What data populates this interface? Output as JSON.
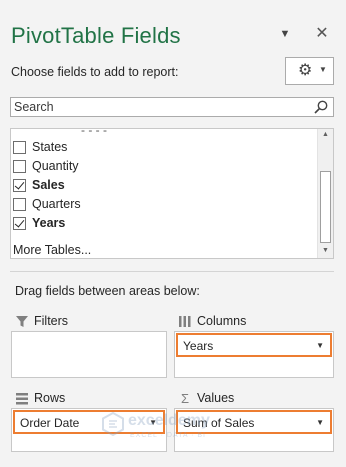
{
  "pane": {
    "title": "PivotTable Fields",
    "dropdown_glyph": "▼",
    "close_glyph": "✕",
    "choose_label": "Choose fields to add to report:",
    "tools_icon": "gear-icon"
  },
  "search": {
    "placeholder": "Search",
    "value": ""
  },
  "fields": {
    "items": [
      {
        "label": "States",
        "checked": false
      },
      {
        "label": "Quantity",
        "checked": false
      },
      {
        "label": "Sales",
        "checked": true
      },
      {
        "label": "Quarters",
        "checked": false
      },
      {
        "label": "Years",
        "checked": true
      }
    ],
    "more_tables": "More Tables..."
  },
  "areas": {
    "drag_label": "Drag fields between areas below:",
    "filters": {
      "label": "Filters",
      "items": []
    },
    "columns": {
      "label": "Columns",
      "items": [
        "Years"
      ]
    },
    "rows": {
      "label": "Rows",
      "items": [
        "Order Date"
      ]
    },
    "values": {
      "label": "Values",
      "items": [
        "Sum of Sales"
      ]
    }
  },
  "watermark": {
    "name": "exceldemy",
    "sub": "EXCEL · DATA · BI"
  },
  "colors": {
    "title": "#217346",
    "highlight": "#ed7d31"
  }
}
